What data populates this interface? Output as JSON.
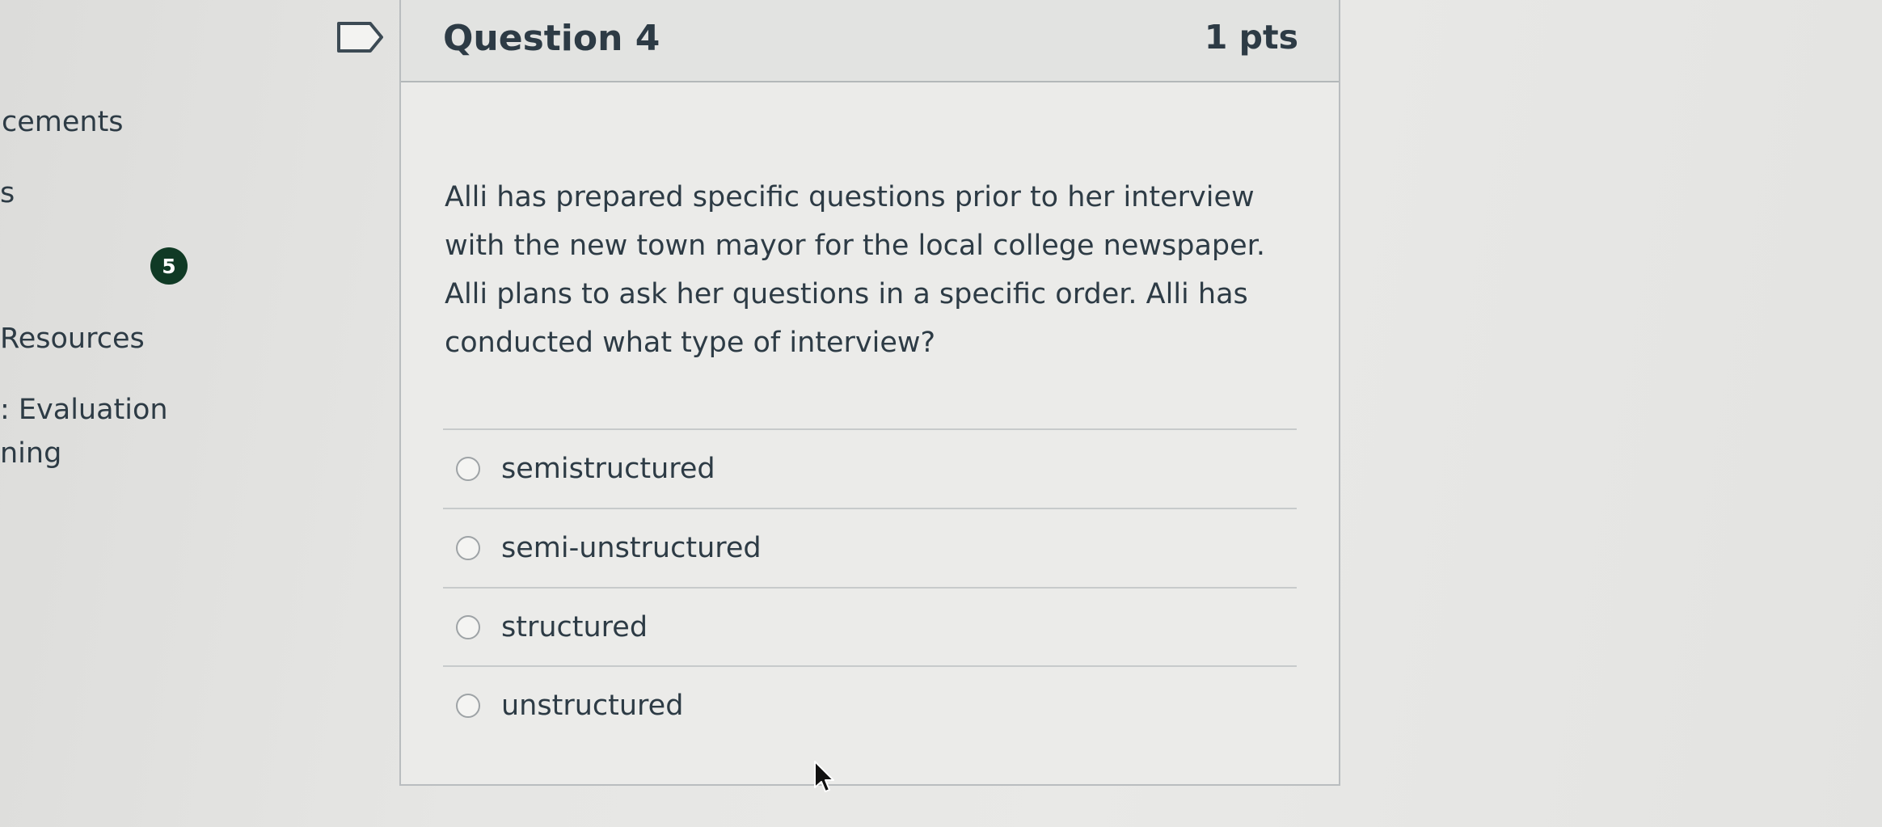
{
  "nav": {
    "items": [
      {
        "label": "cements"
      },
      {
        "label": "s"
      },
      {
        "label": "Resources"
      },
      {
        "label": ": Evaluation"
      },
      {
        "label": "ning"
      }
    ],
    "badge_count": "5"
  },
  "question": {
    "title": "Question 4",
    "points": "1 pts",
    "text": "Alli has prepared specific questions prior to her interview with the new town mayor for the local college newspaper. Alli plans to ask her questions in a specific order. Alli has conducted what type of interview?",
    "answers": [
      {
        "label": "semistructured"
      },
      {
        "label": "semi-unstructured"
      },
      {
        "label": "structured"
      },
      {
        "label": "unstructured"
      }
    ]
  },
  "icons": {
    "flag": "bookmark-flag-icon",
    "radio": "radio-button-icon",
    "cursor": "mouse-pointer-icon"
  },
  "colors": {
    "text": "#2d3b45",
    "badge": "#103a25",
    "card_border": "#b9bdbf"
  }
}
